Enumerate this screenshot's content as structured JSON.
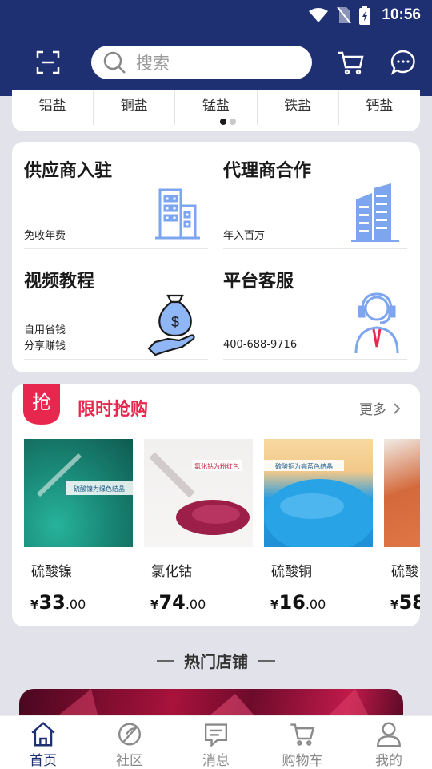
{
  "status_bar": {
    "time": "10:56"
  },
  "header": {
    "search_placeholder": "搜索"
  },
  "categories": [
    "铝盐",
    "铜盐",
    "锰盐",
    "铁盐",
    "钙盐"
  ],
  "services": [
    {
      "title": "供应商入驻",
      "sub": [
        "免收年费"
      ]
    },
    {
      "title": "代理商合作",
      "sub": [
        "年入百万"
      ]
    },
    {
      "title": "视频教程",
      "sub": [
        "自用省钱",
        "分享赚钱"
      ]
    },
    {
      "title": "平台客服",
      "sub": [
        "400-688-9716"
      ]
    }
  ],
  "flash_sale": {
    "badge": "抢",
    "title": "限时抢购",
    "more": "更多",
    "products": [
      {
        "name": "硫酸镍",
        "currency": "¥",
        "price_int": "33",
        "price_dec": ".00",
        "label": "硫酸镍为绿色结晶",
        "color": "#1f9a88"
      },
      {
        "name": "氯化钴",
        "currency": "¥",
        "price_int": "74",
        "price_dec": ".00",
        "label": "氯化钴为粉红色",
        "color": "#9c1f49"
      },
      {
        "name": "硫酸铜",
        "currency": "¥",
        "price_int": "16",
        "price_dec": ".00",
        "label": "硫酸铜为亮蓝色结晶",
        "color": "#2a9ee0"
      },
      {
        "name": "硫酸",
        "currency": "¥",
        "price_int": "58",
        "price_dec": "",
        "label": "",
        "color": "#d46a3c"
      }
    ]
  },
  "hot_shops": {
    "title": "热门店铺"
  },
  "tabbar": [
    {
      "label": "首页",
      "icon": "home-icon",
      "active": true
    },
    {
      "label": "社区",
      "icon": "community-icon",
      "active": false
    },
    {
      "label": "消息",
      "icon": "message-icon",
      "active": false
    },
    {
      "label": "购物车",
      "icon": "cart-icon",
      "active": false
    },
    {
      "label": "我的",
      "icon": "profile-icon",
      "active": false
    }
  ],
  "colors": {
    "brand": "#1e2f72",
    "accent": "#e8274e",
    "icon_blue": "#7ea6f0"
  }
}
